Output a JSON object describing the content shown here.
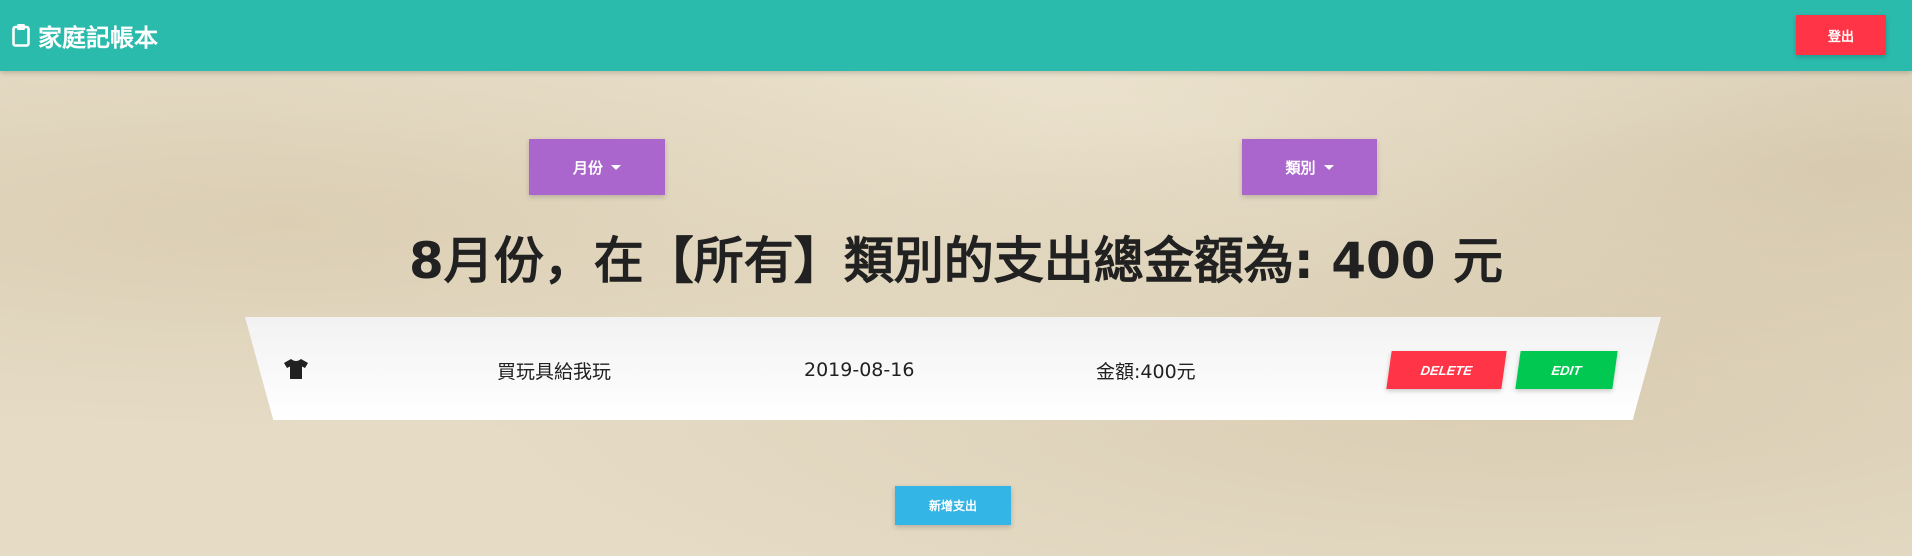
{
  "navbar": {
    "brand_icon": "clipboard-icon",
    "brand_title": "家庭記帳本",
    "logout_label": "登出",
    "bg_color": "#2bbbad"
  },
  "filters": {
    "month_label": "月份",
    "category_label": "類別",
    "dropdown_icon": "caret-down-icon",
    "color": "#aa66cc"
  },
  "summary": {
    "text": "8月份，在【所有】類別的支出總金額為: 400 元"
  },
  "expenses": [
    {
      "icon": "tshirt-icon",
      "name": "買玩具給我玩",
      "date": "2019-08-16",
      "amount": "金額:400元",
      "delete_label": "DELETE",
      "edit_label": "EDIT"
    }
  ],
  "actions": {
    "add_label": "新增支出"
  },
  "colors": {
    "danger": "#ff3547",
    "success": "#00c851",
    "info": "#33b5e5"
  }
}
